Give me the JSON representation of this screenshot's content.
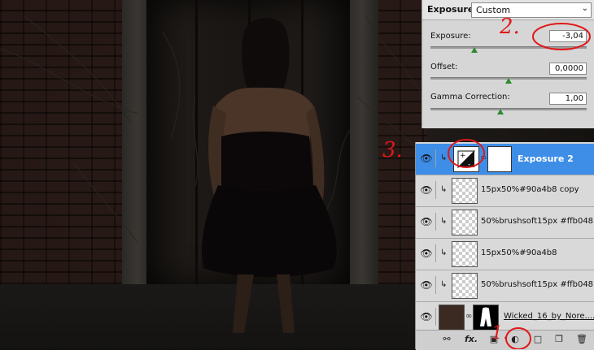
{
  "exposure_panel": {
    "title": "Exposure",
    "preset_value": "Custom",
    "preset_arrow_icon": "chevron-down-icon",
    "controls": [
      {
        "label": "Exposure:",
        "value": "-3,04",
        "slider_fraction": 0.28
      },
      {
        "label": "Offset:",
        "value": "0,0000",
        "slider_fraction": 0.5
      },
      {
        "label": "Gamma Correction:",
        "value": "1,00",
        "slider_fraction": 0.45
      }
    ]
  },
  "layers_panel": {
    "layers": [
      {
        "name": "Exposure 2",
        "selected": true,
        "kind": "adjustment"
      },
      {
        "name": "15px50%#90a4b8 copy",
        "selected": false,
        "kind": "pixel"
      },
      {
        "name": "50%brushsoft15px #ffb048...",
        "selected": false,
        "kind": "pixel"
      },
      {
        "name": "15px50%#90a4b8",
        "selected": false,
        "kind": "pixel"
      },
      {
        "name": "50%brushsoft15px #ffb048",
        "selected": false,
        "kind": "pixel"
      },
      {
        "name": "Wicked_16_by_Nore....",
        "selected": false,
        "kind": "masked"
      }
    ],
    "bottom_icons": [
      "link-icon",
      "fx-icon",
      "add-mask-icon",
      "adjustment-layer-icon",
      "new-group-icon",
      "new-layer-icon",
      "trash-icon"
    ],
    "fx_label": "fx."
  },
  "annotations": {
    "one": "1.",
    "two": "2.",
    "three": "3."
  },
  "colors": {
    "selection_blue": "#3e8ee8",
    "annotation_red": "#e01818",
    "slider_green": "#2f8a2f"
  }
}
